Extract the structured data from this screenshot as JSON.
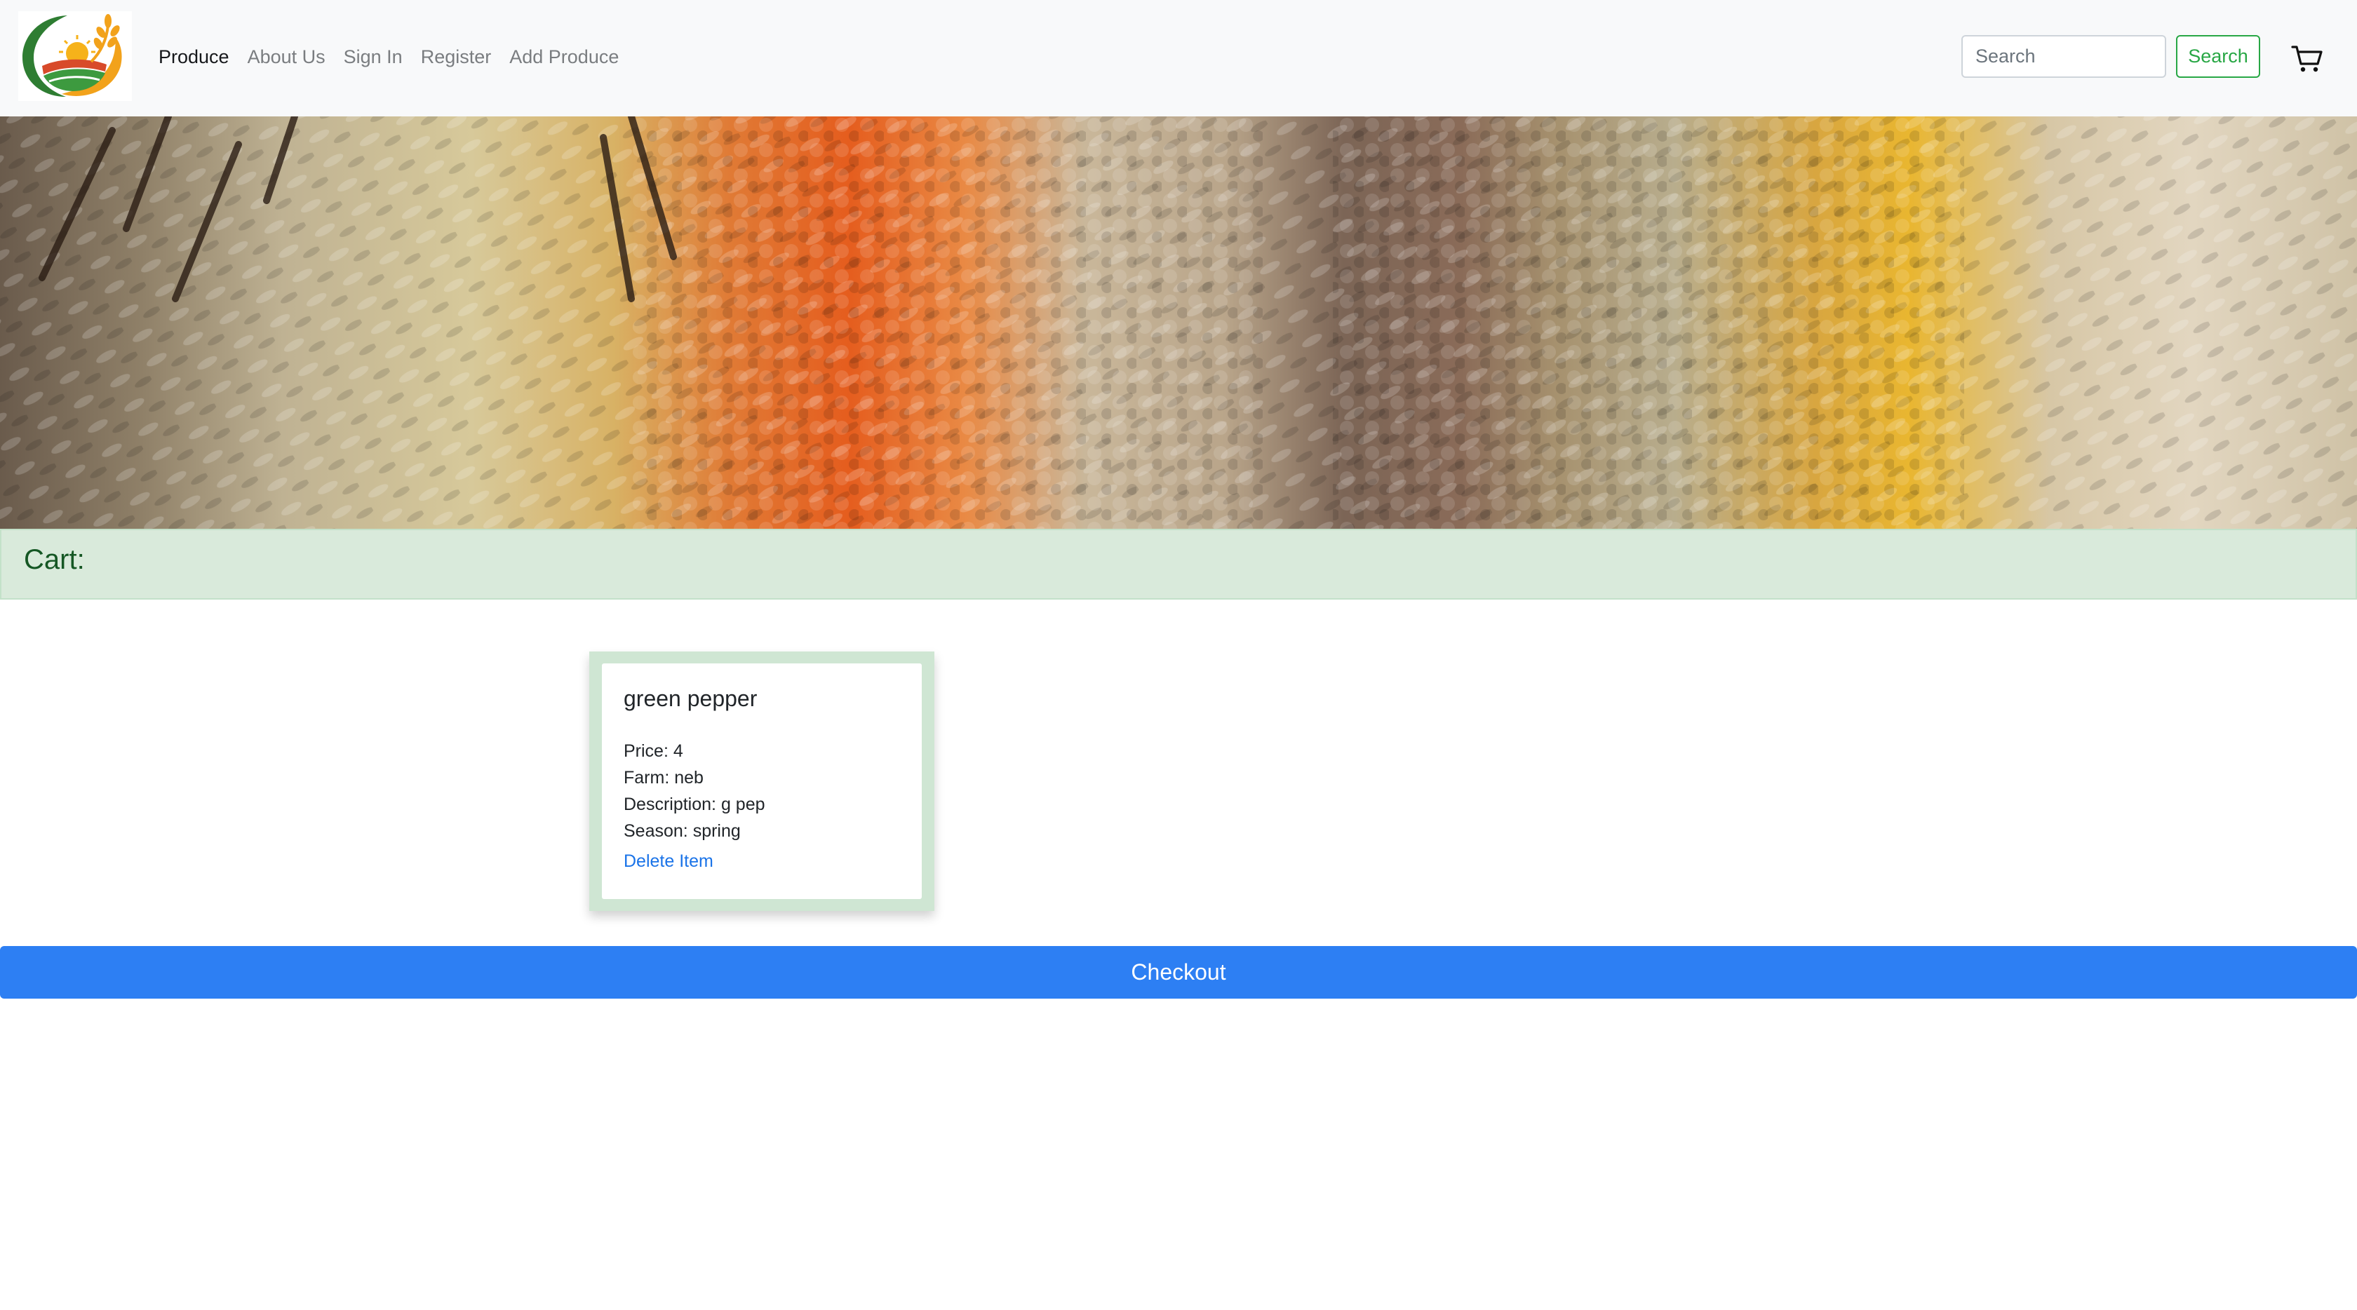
{
  "navbar": {
    "logo_icon": "farm-sunrise-logo",
    "links": [
      {
        "label": "Produce",
        "active": true
      },
      {
        "label": "About Us",
        "active": false
      },
      {
        "label": "Sign In",
        "active": false
      },
      {
        "label": "Register",
        "active": false
      },
      {
        "label": "Add Produce",
        "active": false
      }
    ],
    "search": {
      "placeholder": "Search",
      "value": "",
      "button_label": "Search"
    },
    "cart_icon": "shopping-cart-icon"
  },
  "banner": {
    "image_subject": "grains-and-lentils"
  },
  "cart": {
    "title": "Cart:",
    "items": [
      {
        "name": "green pepper",
        "price_label": "Price:",
        "price": "4",
        "farm_label": "Farm:",
        "farm": "neb",
        "description_label": "Description:",
        "description": "g pep",
        "season_label": "Season:",
        "season": "spring",
        "delete_label": "Delete Item"
      }
    ]
  },
  "checkout": {
    "label": "Checkout"
  },
  "colors": {
    "navbar_bg": "#f8f9fa",
    "search_button": "#28a745",
    "cart_header_bg": "#d9eadb",
    "cart_title": "#155724",
    "link": "#1a73e8",
    "checkout_bg": "#2d7ff3"
  }
}
